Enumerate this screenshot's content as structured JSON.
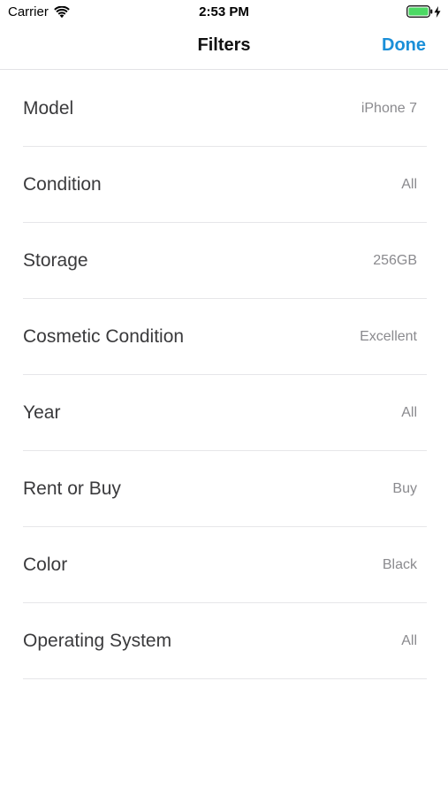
{
  "status_bar": {
    "carrier": "Carrier",
    "time": "2:53 PM",
    "battery_color": "#4cd964"
  },
  "nav": {
    "title": "Filters",
    "done_label": "Done",
    "accent_color": "#1a8fd8"
  },
  "filters": [
    {
      "label": "Model",
      "value": "iPhone 7"
    },
    {
      "label": "Condition",
      "value": "All"
    },
    {
      "label": "Storage",
      "value": "256GB"
    },
    {
      "label": "Cosmetic Condition",
      "value": "Excellent"
    },
    {
      "label": "Year",
      "value": "All"
    },
    {
      "label": "Rent or Buy",
      "value": "Buy"
    },
    {
      "label": "Color",
      "value": "Black"
    },
    {
      "label": "Operating System",
      "value": "All"
    }
  ]
}
